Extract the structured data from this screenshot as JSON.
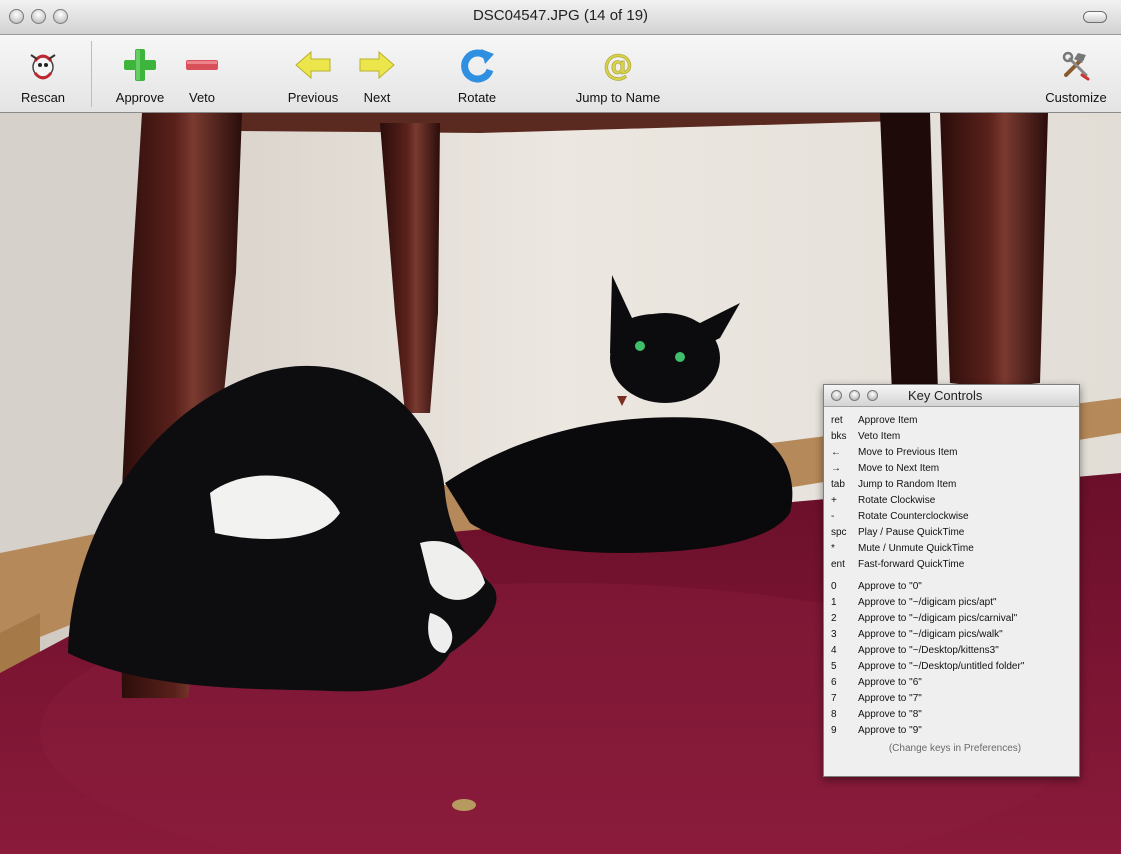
{
  "window": {
    "title": "DSC04547.JPG (14 of 19)"
  },
  "toolbar": {
    "rescan": "Rescan",
    "approve": "Approve",
    "veto": "Veto",
    "previous": "Previous",
    "next": "Next",
    "rotate": "Rotate",
    "jump": "Jump to Name",
    "customize": "Customize"
  },
  "icons": {
    "rescan": "rescan-icon",
    "approve": "plus-icon",
    "veto": "minus-icon",
    "previous": "arrow-left-icon",
    "next": "arrow-right-icon",
    "rotate": "rotate-icon",
    "jump": "at-icon",
    "customize": "tools-icon"
  },
  "colors": {
    "approve_green": "#3db53d",
    "veto_red": "#d9505a",
    "arrow_yellow": "#e8e24a",
    "rotate_blue": "#2f8fe0",
    "carpet": "#7a1230",
    "wall": "#e8e3dc"
  },
  "key_controls": {
    "title": "Key Controls",
    "rows": [
      {
        "key": "ret",
        "action": "Approve Item"
      },
      {
        "key": "bks",
        "action": "Veto Item"
      },
      {
        "key": "←",
        "action": "Move to Previous Item"
      },
      {
        "key": "→",
        "action": "Move to Next Item"
      },
      {
        "key": "tab",
        "action": "Jump to Random Item"
      },
      {
        "key": "+",
        "action": "Rotate Clockwise"
      },
      {
        "key": "-",
        "action": "Rotate Counterclockwise"
      },
      {
        "key": "spc",
        "action": "Play / Pause QuickTime"
      },
      {
        "key": "*",
        "action": "Mute / Unmute QuickTime"
      },
      {
        "key": "ent",
        "action": "Fast-forward QuickTime"
      }
    ],
    "number_rows": [
      {
        "key": "0",
        "action": "Approve to \"0\""
      },
      {
        "key": "1",
        "action": "Approve to \"~/digicam pics/apt\""
      },
      {
        "key": "2",
        "action": "Approve to \"~/digicam pics/carnival\""
      },
      {
        "key": "3",
        "action": "Approve to \"~/digicam pics/walk\""
      },
      {
        "key": "4",
        "action": "Approve to \"~/Desktop/kittens3\""
      },
      {
        "key": "5",
        "action": "Approve to \"~/Desktop/untitled folder\""
      },
      {
        "key": "6",
        "action": "Approve to \"6\""
      },
      {
        "key": "7",
        "action": "Approve to \"7\""
      },
      {
        "key": "8",
        "action": "Approve to \"8\""
      },
      {
        "key": "9",
        "action": "Approve to \"9\""
      }
    ],
    "footer": "(Change keys in Preferences)"
  }
}
